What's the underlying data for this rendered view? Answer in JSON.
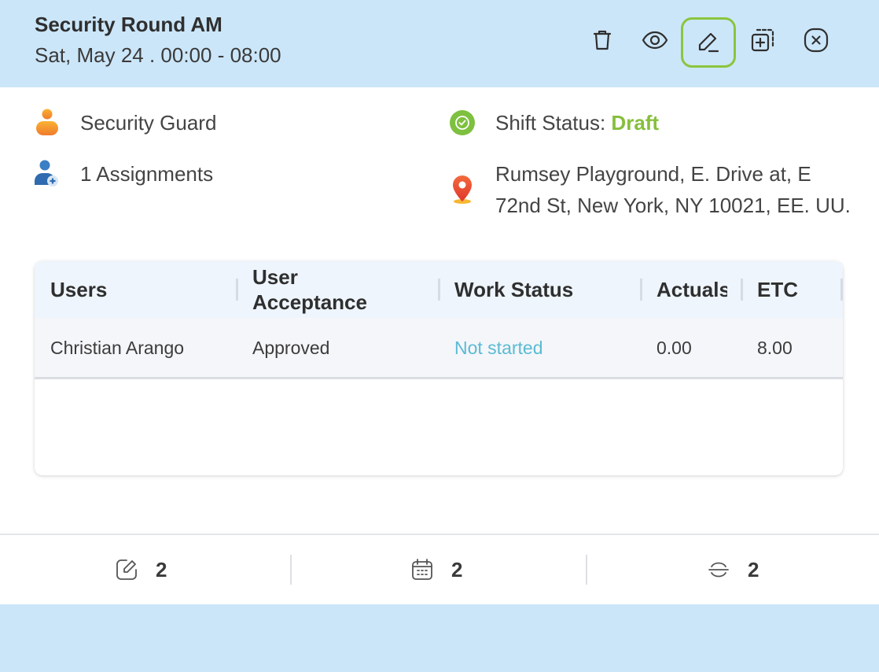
{
  "header": {
    "title": "Security Round AM",
    "subtitle": "Sat, May 24 . 00:00 - 08:00",
    "actions": [
      "trash-icon",
      "eye-icon",
      "edit-pencil-icon",
      "duplicate-icon",
      "close-circle-icon"
    ],
    "active_action": "edit-pencil-icon",
    "active_color": "#8ac53e",
    "background": "#cce6f9"
  },
  "info": {
    "role": "Security Guard",
    "assignments": "1 Assignments",
    "status_label": "Shift Status:",
    "status_value": "Draft",
    "status_color": "#86bf3c",
    "address_line1": "Rumsey Playground, E. Drive at, E",
    "address_line2": "72nd St, New York, NY 10021, EE. UU."
  },
  "table": {
    "columns": [
      "Users",
      "User Acceptance",
      "Work Status",
      "Actuals",
      "ETC"
    ],
    "rows": [
      {
        "user": "Christian Arango",
        "acceptance": "Approved",
        "work_status": "Not started",
        "actuals": "0.00",
        "etc": "8.00"
      }
    ]
  },
  "footer": {
    "stats": [
      {
        "icon": "edit-note-icon",
        "value": "2"
      },
      {
        "icon": "calendar-icon",
        "value": "2"
      },
      {
        "icon": "strikethrough-icon",
        "value": "2"
      }
    ]
  }
}
